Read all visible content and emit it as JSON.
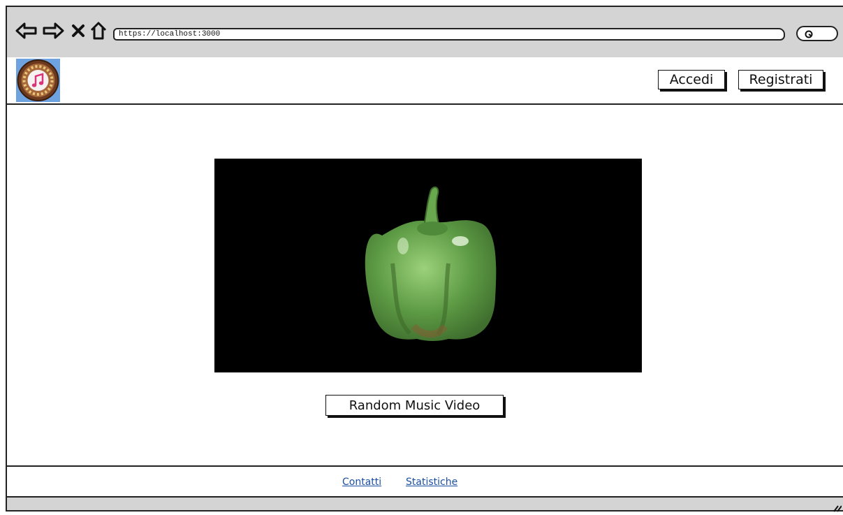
{
  "browser": {
    "url": "https://localhost:3000"
  },
  "header": {
    "login_label": "Accedi",
    "register_label": "Registrati"
  },
  "main": {
    "random_button_label": "Random Music Video"
  },
  "footer": {
    "links": [
      "Contatti",
      "Statistiche"
    ]
  },
  "colors": {
    "chrome": "#d4d4d4",
    "link": "#1a4fa0",
    "video_bg": "#000000",
    "logo_bg": "#6fa3e0"
  }
}
